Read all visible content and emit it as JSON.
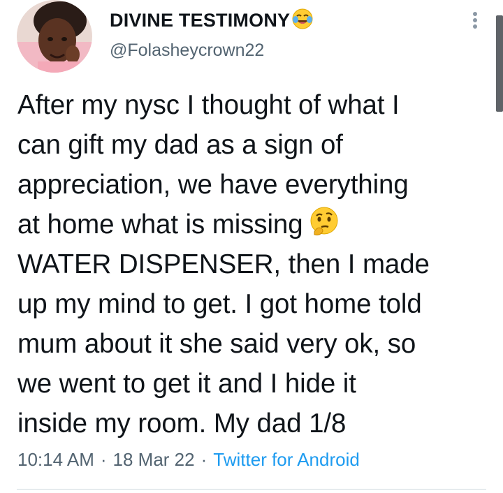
{
  "author": {
    "display_name": "DIVINE TESTIMONY",
    "name_emoji": "face-with-tears-of-joy-icon",
    "handle": "@Folasheycrown22",
    "avatar": "profile-photo"
  },
  "tweet": {
    "text_part1": "After my nysc I thought of what I\ncan gift my dad as a sign of\nappreciation, we have everything\nat home what is missing",
    "inline_emoji": "thinking-face-icon",
    "text_part2": "WATER DISPENSER, then I made\nup my mind to get. I got home told\nmum about it she said very ok, so\nwe went to get it and I hide it\ninside my room. My dad 1/8"
  },
  "meta": {
    "time": "10:14 AM",
    "separator": "·",
    "date": "18 Mar 22",
    "source": "Twitter for Android"
  },
  "colors": {
    "text": "#0f1419",
    "secondary": "#536471",
    "link": "#1d9bf0",
    "divider": "#cfd9de"
  },
  "icons": {
    "more": "more-vertical-icon"
  }
}
